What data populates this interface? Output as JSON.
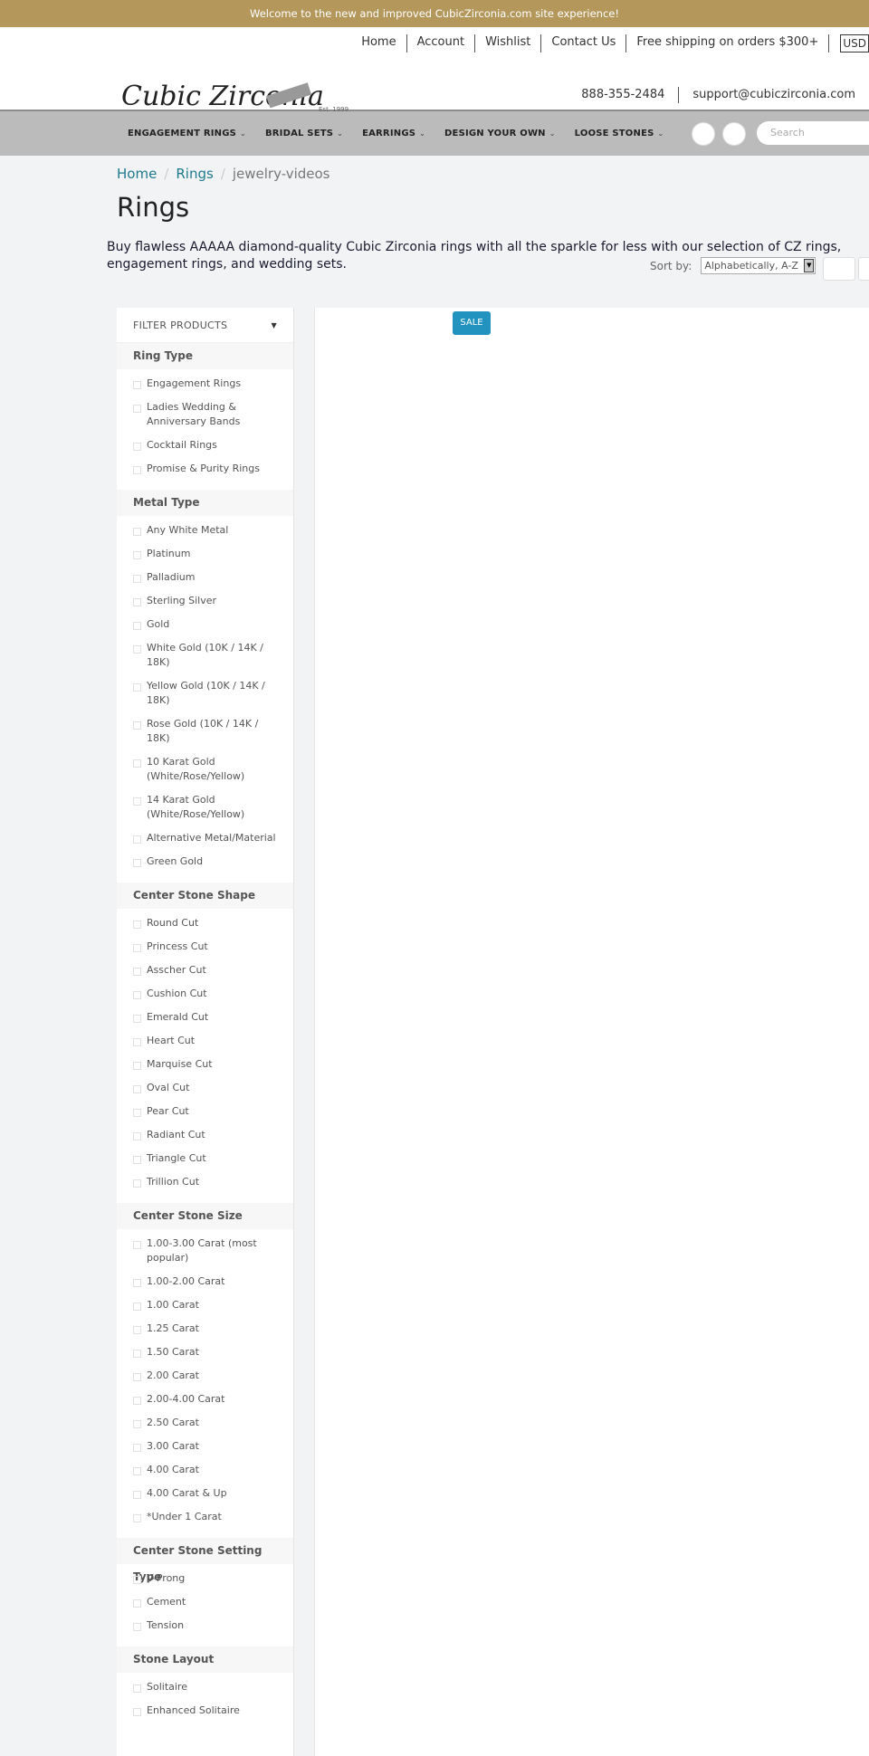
{
  "topbar": {
    "message": "Welcome to the new and improved CubicZirconia.com site experience!"
  },
  "header": {
    "logo_text": "Cubic Zirconia",
    "logo_est": "Est. 1999",
    "links": [
      "Home",
      "Account",
      "Wishlist",
      "Contact Us",
      "Free shipping on orders $300+"
    ],
    "currency": "USD",
    "phone": "888-355-2484",
    "email": "support@cubiczirconia.com"
  },
  "nav": {
    "items": [
      "ENGAGEMENT RINGS",
      "BRIDAL SETS",
      "EARRINGS",
      "DESIGN YOUR OWN",
      "LOOSE STONES"
    ],
    "search_placeholder": "Search"
  },
  "breadcrumb": [
    "Home",
    "Rings",
    "jewelry-videos"
  ],
  "page": {
    "title": "Rings",
    "description": "Buy flawless AAAAA diamond-quality Cubic Zirconia rings with all the sparkle for less with our selection of CZ rings, engagement rings, and wedding sets.",
    "sort_label": "Sort by:",
    "sort_value": "Alphabetically, A-Z",
    "sale_badge": "SALE"
  },
  "filter": {
    "title": "FILTER PRODUCTS",
    "sections": [
      {
        "title": "Ring Type",
        "options": [
          "Engagement Rings",
          "Ladies Wedding & Anniversary Bands",
          "Cocktail Rings",
          "Promise & Purity Rings"
        ]
      },
      {
        "title": "Metal Type",
        "options": [
          "Any White Metal",
          "Platinum",
          "Palladium",
          "Sterling Silver",
          "Gold",
          "White Gold (10K / 14K / 18K)",
          "Yellow Gold (10K / 14K / 18K)",
          "Rose Gold (10K / 14K / 18K)",
          "10 Karat Gold (White/Rose/Yellow)",
          "14 Karat Gold (White/Rose/Yellow)",
          "Alternative Metal/Material",
          "Green Gold"
        ]
      },
      {
        "title": "Center Stone Shape",
        "options": [
          "Round Cut",
          "Princess Cut",
          "Asscher Cut",
          "Cushion Cut",
          "Emerald Cut",
          "Heart Cut",
          "Marquise Cut",
          "Oval Cut",
          "Pear Cut",
          "Radiant Cut",
          "Triangle Cut",
          "Trillion Cut"
        ]
      },
      {
        "title": "Center Stone Size",
        "options": [
          "1.00-3.00 Carat (most popular)",
          "1.00-2.00 Carat",
          "1.00 Carat",
          "1.25 Carat",
          "1.50 Carat",
          "2.00 Carat",
          "2.00-4.00 Carat",
          "2.50 Carat",
          "3.00 Carat",
          "4.00 Carat",
          "4.00 Carat & Up",
          "*Under 1 Carat"
        ]
      },
      {
        "title": "Center Stone Setting Type",
        "options": [
          "V-Prong",
          "Cement",
          "Tension"
        ]
      },
      {
        "title": "Stone Layout",
        "options": [
          "Solitaire",
          "Enhanced Solitaire"
        ]
      }
    ]
  }
}
